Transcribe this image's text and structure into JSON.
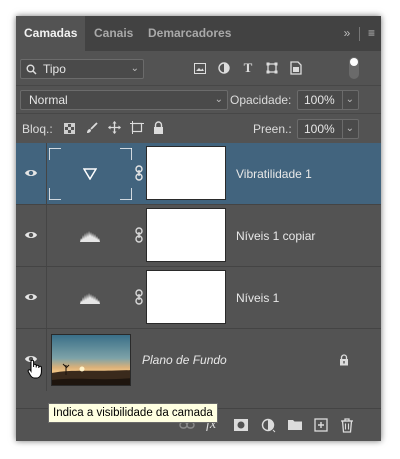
{
  "tabs": [
    {
      "label": "Camadas"
    },
    {
      "label": "Canais"
    },
    {
      "label": "Demarcadores"
    }
  ],
  "panel_menu": {
    "expand_glyph": "»",
    "menu_glyph": "≡"
  },
  "filter": {
    "label": "Tipo"
  },
  "blend": {
    "mode": "Normal",
    "opacity_label": "Opacidade:",
    "opacity_value": "100%"
  },
  "lock": {
    "label": "Bloq.:",
    "fill_label": "Preen.:",
    "fill_value": "100%"
  },
  "layers": [
    {
      "name": "Vibratilidade 1",
      "kind": "vibrance",
      "selected": true
    },
    {
      "name": "Níveis 1 copiar",
      "kind": "levels",
      "selected": false
    },
    {
      "name": "Níveis 1",
      "kind": "levels",
      "selected": false
    },
    {
      "name": "Plano de Fundo",
      "kind": "background",
      "selected": false,
      "locked": true
    }
  ],
  "tooltip": {
    "text": "Indica a visibilidade da camada"
  },
  "colors": {
    "panel": "#535353",
    "selected_row": "#42647e",
    "tooltip_bg": "#ffffe1"
  }
}
